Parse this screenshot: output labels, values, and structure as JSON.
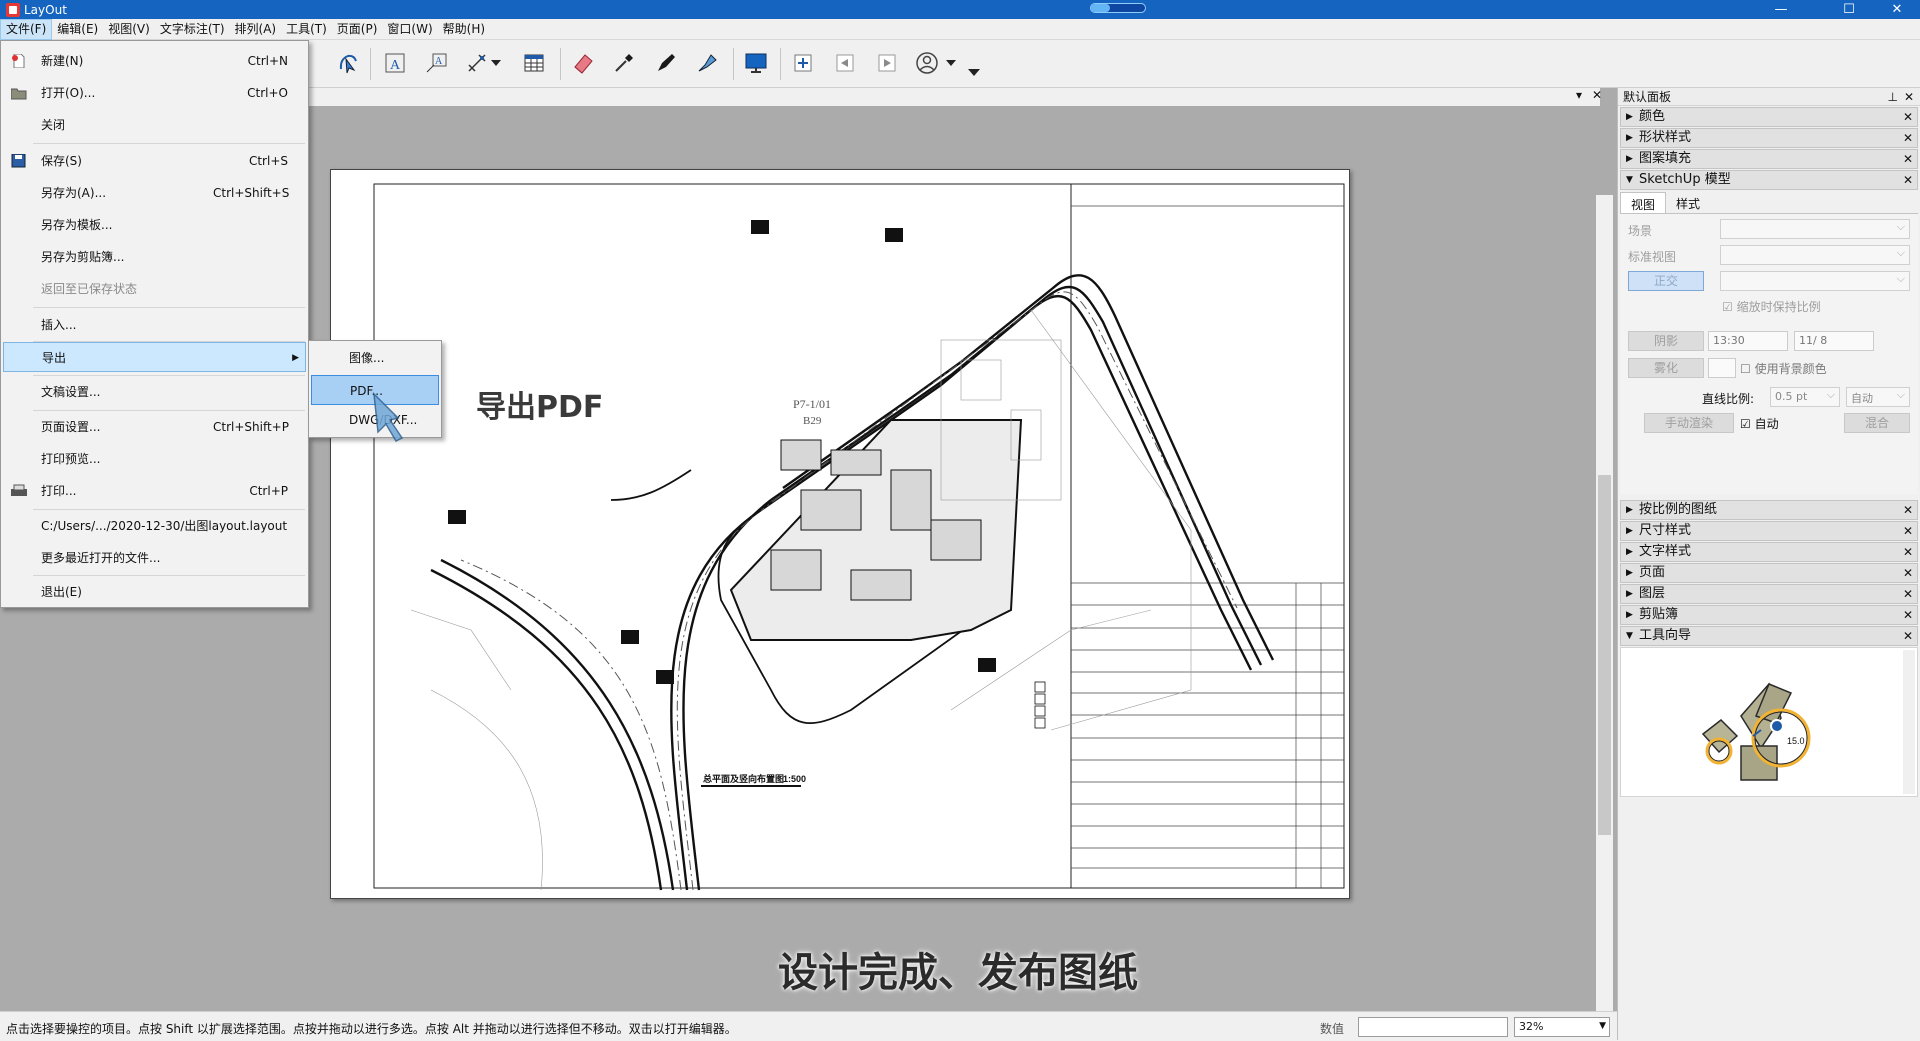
{
  "window": {
    "title": "LayOut",
    "progress": 0.35
  },
  "menubar": [
    {
      "label": "文件(F)"
    },
    {
      "label": "编辑(E)"
    },
    {
      "label": "视图(V)"
    },
    {
      "label": "文字标注(T)"
    },
    {
      "label": "排列(A)"
    },
    {
      "label": "工具(T)"
    },
    {
      "label": "页面(P)"
    },
    {
      "label": "窗口(W)"
    },
    {
      "label": "帮助(H)"
    }
  ],
  "file_menu": {
    "items": [
      {
        "label": "新建(N)",
        "shortcut": "Ctrl+N"
      },
      {
        "label": "打开(O)...",
        "shortcut": "Ctrl+O"
      },
      {
        "label": "关闭",
        "shortcut": ""
      },
      {
        "label": "保存(S)",
        "shortcut": "Ctrl+S"
      },
      {
        "label": "另存为(A)...",
        "shortcut": "Ctrl+Shift+S"
      },
      {
        "label": "另存为模板...",
        "shortcut": ""
      },
      {
        "label": "另存为剪贴簿...",
        "shortcut": ""
      },
      {
        "label": "返回至已保存状态",
        "shortcut": ""
      },
      {
        "label": "插入...",
        "shortcut": ""
      },
      {
        "label": "导出",
        "shortcut": ""
      },
      {
        "label": "文稿设置...",
        "shortcut": ""
      },
      {
        "label": "页面设置...",
        "shortcut": "Ctrl+Shift+P"
      },
      {
        "label": "打印预览...",
        "shortcut": ""
      },
      {
        "label": "打印...",
        "shortcut": "Ctrl+P"
      },
      {
        "label": "C:/Users/.../2020-12-30/出图layout.layout",
        "shortcut": ""
      },
      {
        "label": "更多最近打开的文件...",
        "shortcut": ""
      },
      {
        "label": "退出(E)",
        "shortcut": ""
      }
    ],
    "export_submenu": [
      {
        "label": "图像..."
      },
      {
        "label": "PDF..."
      },
      {
        "label": "DWG/DXF..."
      }
    ]
  },
  "overlay": {
    "export_pdf_caption": "导出PDF",
    "subtitle": "设计完成、发布图纸"
  },
  "drawing": {
    "plot_label": "P7-1/01",
    "plot_code": "B29",
    "sheet_title": "总平面及竖向布置图",
    "sheet_scale": "1:500"
  },
  "panel": {
    "title": "默认面板",
    "sections_top": [
      {
        "label": "颜色",
        "expanded": false
      },
      {
        "label": "形状样式",
        "expanded": false
      },
      {
        "label": "图案填充",
        "expanded": false
      },
      {
        "label": "SketchUp 模型",
        "expanded": true
      }
    ],
    "sketchup": {
      "tabs": [
        {
          "label": "视图"
        },
        {
          "label": "样式"
        }
      ],
      "scene_label": "场景",
      "standard_view_label": "标准视图",
      "ortho_button": "正交",
      "keep_scale_label": "缩放时保持比例",
      "shadow_button": "阴影",
      "time_value": "13:30",
      "date_value": "11/ 8",
      "fog_button": "雾化",
      "use_bg_color_label": "使用背景颜色",
      "line_scale_label": "直线比例:",
      "line_scale_value": "0.5 pt",
      "auto_select": "自动",
      "manual_render_button": "手动渲染",
      "auto_checkbox": "自动",
      "blend_select": "混合"
    },
    "sections_bottom": [
      {
        "label": "按比例的图纸",
        "expanded": false
      },
      {
        "label": "尺寸样式",
        "expanded": false
      },
      {
        "label": "文字样式",
        "expanded": false
      },
      {
        "label": "页面",
        "expanded": false
      },
      {
        "label": "图层",
        "expanded": false
      },
      {
        "label": "剪贴簿",
        "expanded": false
      },
      {
        "label": "工具向导",
        "expanded": true
      }
    ],
    "guide_value": "15.0"
  },
  "statusbar": {
    "message": "点击选择要操控的项目。点按 Shift 以扩展选择范围。点按并拖动以进行多选。点按 Alt 并拖动以进行选择但不移动。双击以打开编辑器。",
    "value_label": "数值",
    "zoom": "32%"
  },
  "icons": [
    "new-file-icon",
    "open-folder-icon",
    "save-disk-icon",
    "printer-icon",
    "text-tool-icon",
    "label-tool-icon",
    "dimension-tool-icon",
    "table-tool-icon",
    "eraser-icon",
    "eyedropper-icon",
    "pen-icon",
    "style-brush-icon",
    "presentation-icon",
    "add-page-icon",
    "previous-page-icon",
    "next-page-icon",
    "user-account-icon"
  ]
}
